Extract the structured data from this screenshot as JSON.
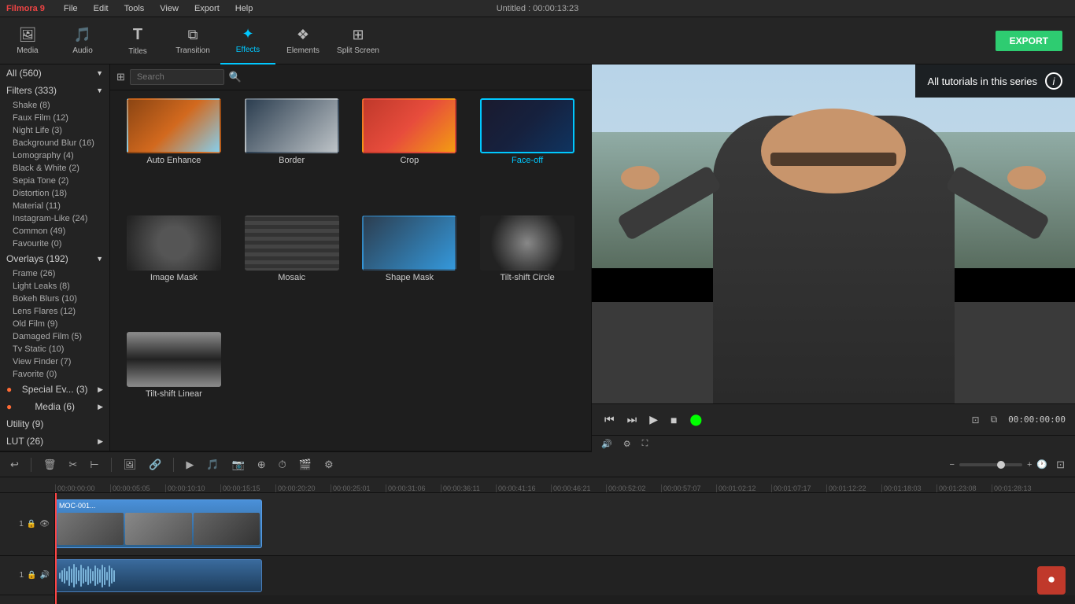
{
  "app": {
    "name": "Filmora 9",
    "title": "Untitled : 00:00:13:23",
    "menu_items": [
      "File",
      "Edit",
      "Tools",
      "View",
      "Export",
      "Help"
    ]
  },
  "toolbar": {
    "items": [
      {
        "id": "media",
        "label": "Media",
        "icon": "🖼"
      },
      {
        "id": "audio",
        "label": "Audio",
        "icon": "🎵"
      },
      {
        "id": "titles",
        "label": "Titles",
        "icon": "T"
      },
      {
        "id": "transition",
        "label": "Transition",
        "icon": "⧉"
      },
      {
        "id": "effects",
        "label": "Effects",
        "icon": "✦"
      },
      {
        "id": "elements",
        "label": "Elements",
        "icon": "❖"
      },
      {
        "id": "split-screen",
        "label": "Split Screen",
        "icon": "⊞"
      }
    ],
    "export_label": "EXPORT"
  },
  "left_panel": {
    "all_label": "All (560)",
    "sections": [
      {
        "label": "Filters (333)",
        "expanded": true,
        "items": [
          "Shake (8)",
          "Faux Film (12)",
          "Night Life (3)",
          "Background Blur (16)",
          "Lomography (4)",
          "Black & White (2)",
          "Sepia Tone (2)",
          "Distortion (18)",
          "Material (11)",
          "Instagram-Like (24)",
          "Common (49)",
          "Favourite (0)"
        ]
      },
      {
        "label": "Overlays (192)",
        "expanded": true,
        "items": [
          "Frame (26)",
          "Light Leaks (8)",
          "Bokeh Blurs (10)",
          "Lens Flares (12)",
          "Old Film (9)",
          "Damaged Film (5)",
          "Tv Static (10)",
          "View Finder (7)",
          "Favorite (0)"
        ]
      },
      {
        "label": "Special Ev... (3)",
        "expanded": false,
        "items": []
      },
      {
        "label": "Media (6)",
        "expanded": false,
        "items": []
      },
      {
        "label": "Utility (9)",
        "expanded": false,
        "items": []
      },
      {
        "label": "LUT (26)",
        "expanded": false,
        "items": []
      }
    ]
  },
  "effects_grid": {
    "search_placeholder": "Search",
    "items": [
      {
        "label": "Auto Enhance",
        "selected": false,
        "thumb": "thumb-auto"
      },
      {
        "label": "Border",
        "selected": false,
        "thumb": "thumb-border"
      },
      {
        "label": "Crop",
        "selected": false,
        "thumb": "thumb-crop"
      },
      {
        "label": "Face-off",
        "selected": true,
        "thumb": "thumb-faceoff"
      },
      {
        "label": "Image Mask",
        "selected": false,
        "thumb": "thumb-imagemask"
      },
      {
        "label": "Mosaic",
        "selected": false,
        "thumb": "thumb-mosaic"
      },
      {
        "label": "Shape Mask",
        "selected": false,
        "thumb": "thumb-shapemask"
      },
      {
        "label": "Tilt-shift Circle",
        "selected": false,
        "thumb": "thumb-tiltcircle"
      },
      {
        "label": "Tilt-shift Linear",
        "selected": false,
        "thumb": "thumb-tiltlinear"
      }
    ]
  },
  "preview": {
    "time_display": "00:00:00:00",
    "controls": [
      "⏮",
      "⏭",
      "▶",
      "■",
      "⬤"
    ],
    "info_text": "All tutorials in this series",
    "info_icon": "i"
  },
  "timeline": {
    "time_markers": [
      "00:00:00:00",
      "00:00:05:05",
      "00:00:10:10",
      "00:00:15:15",
      "00:00:20:20",
      "00:00:25:01",
      "00:00:31:06",
      "00:00:36:11",
      "00:00:41:16",
      "00:00:46:21",
      "00:00:52:02",
      "00:00:57:07",
      "00:01:02:12",
      "00:01:07:17",
      "00:01:12:22",
      "00:01:18:03",
      "00:01:23:08",
      "00:01:28:13"
    ],
    "tracks": [
      {
        "type": "video",
        "icons": [
          "1",
          "🔒",
          "👁"
        ]
      },
      {
        "type": "audio",
        "icons": [
          "1",
          "🔒",
          "🔊"
        ]
      }
    ]
  }
}
